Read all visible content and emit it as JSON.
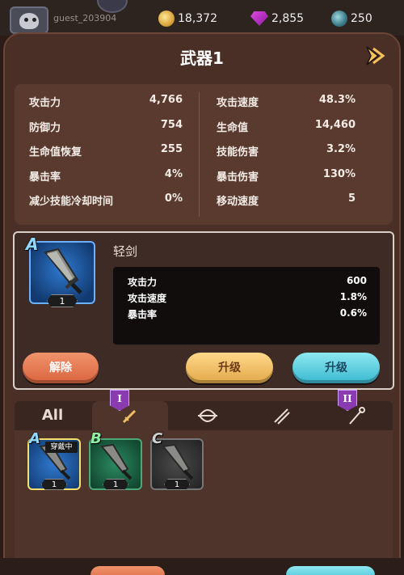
{
  "player": {
    "name": "guest_203904"
  },
  "currency": {
    "coins": "18,372",
    "gems": "2,855",
    "orbs": "250"
  },
  "title": "武器1",
  "stats_left": [
    {
      "label": "攻击力",
      "value": "4,766"
    },
    {
      "label": "防御力",
      "value": "754"
    },
    {
      "label": "生命值恢复",
      "value": "255"
    },
    {
      "label": "暴击率",
      "value": "4%"
    },
    {
      "label": "减少技能冷却时间",
      "value": "0%"
    }
  ],
  "stats_right": [
    {
      "label": "攻击速度",
      "value": "48.3%"
    },
    {
      "label": "生命值",
      "value": "14,460"
    },
    {
      "label": "技能伤害",
      "value": "3.2%"
    },
    {
      "label": "暴击伤害",
      "value": "130%"
    },
    {
      "label": "移动速度",
      "value": "5"
    }
  ],
  "weapon": {
    "rank": "A",
    "level": "1",
    "name": "轻剑",
    "stats": [
      {
        "label": "攻击力",
        "value": "600"
      },
      {
        "label": "攻击速度",
        "value": "1.8%"
      },
      {
        "label": "暴击率",
        "value": "0.6%"
      }
    ]
  },
  "buttons": {
    "unequip": "解除",
    "upgrade1": "升级",
    "upgrade2": "升级"
  },
  "tabs": {
    "all": "All",
    "tag_sword": "I",
    "tag_staff": "II"
  },
  "inventory": [
    {
      "rank": "A",
      "level": "1",
      "badge": "穿戴中"
    },
    {
      "rank": "B",
      "level": "1"
    },
    {
      "rank": "C",
      "level": "1"
    }
  ],
  "colors": {
    "rank_a": "#8fd8ff",
    "rank_b": "#8ef0a0",
    "rank_c": "#cfcfcf",
    "accent_purple": "#8a3bb0"
  }
}
